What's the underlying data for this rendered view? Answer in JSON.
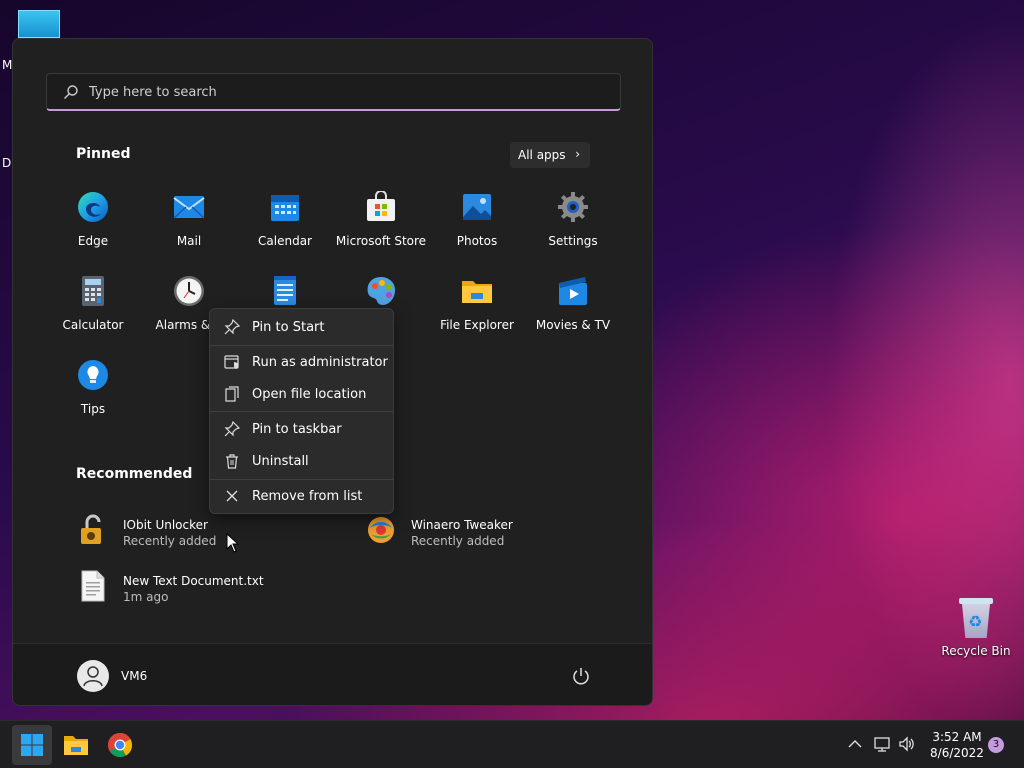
{
  "desktop": {
    "clipped_label_1": "M",
    "clipped_label_2": "Da",
    "recycle_bin_label": "Recycle Bin"
  },
  "start_menu": {
    "search": {
      "placeholder": "Type here to search"
    },
    "pinned_title": "Pinned",
    "all_apps_label": "All apps",
    "pinned_apps": [
      {
        "label": "Edge",
        "icon": "edge-icon"
      },
      {
        "label": "Mail",
        "icon": "mail-icon"
      },
      {
        "label": "Calendar",
        "icon": "calendar-icon"
      },
      {
        "label": "Microsoft Store",
        "icon": "store-icon"
      },
      {
        "label": "Photos",
        "icon": "photos-icon"
      },
      {
        "label": "Settings",
        "icon": "gear-icon"
      },
      {
        "label": "Calculator",
        "icon": "calculator-icon"
      },
      {
        "label": "Alarms & C",
        "icon": "clock-icon"
      },
      {
        "label": "",
        "icon": "notepad-icon"
      },
      {
        "label": "",
        "icon": "paint-icon"
      },
      {
        "label": "File Explorer",
        "icon": "folder-icon"
      },
      {
        "label": "Movies & TV",
        "icon": "movies-icon"
      },
      {
        "label": "Tips",
        "icon": "lightbulb-icon"
      }
    ],
    "recommended_title": "Recommended",
    "recommended": [
      {
        "name": "IObit Unlocker",
        "sub": "Recently added",
        "icon": "unlocker-icon"
      },
      {
        "name": "Winaero Tweaker",
        "sub": "Recently added",
        "icon": "tweaker-icon"
      },
      {
        "name": "New Text Document.txt",
        "sub": "1m ago",
        "icon": "text-file-icon"
      }
    ],
    "user_name": "VM6"
  },
  "context_menu": {
    "items": [
      {
        "label": "Pin to Start",
        "icon": "pin-icon"
      },
      {
        "label": "Run as administrator",
        "icon": "admin-icon"
      },
      {
        "label": "Open file location",
        "icon": "open-location-icon"
      },
      {
        "label": "Pin to taskbar",
        "icon": "pin-icon"
      },
      {
        "label": "Uninstall",
        "icon": "trash-icon"
      },
      {
        "label": "Remove from list",
        "icon": "close-icon"
      }
    ]
  },
  "taskbar": {
    "time": "3:52 AM",
    "date": "8/6/2022",
    "notification_count": "3"
  },
  "colors": {
    "accent": "#c49bd6",
    "menu_bg": "#202020",
    "context_bg": "#2b2b2b"
  }
}
